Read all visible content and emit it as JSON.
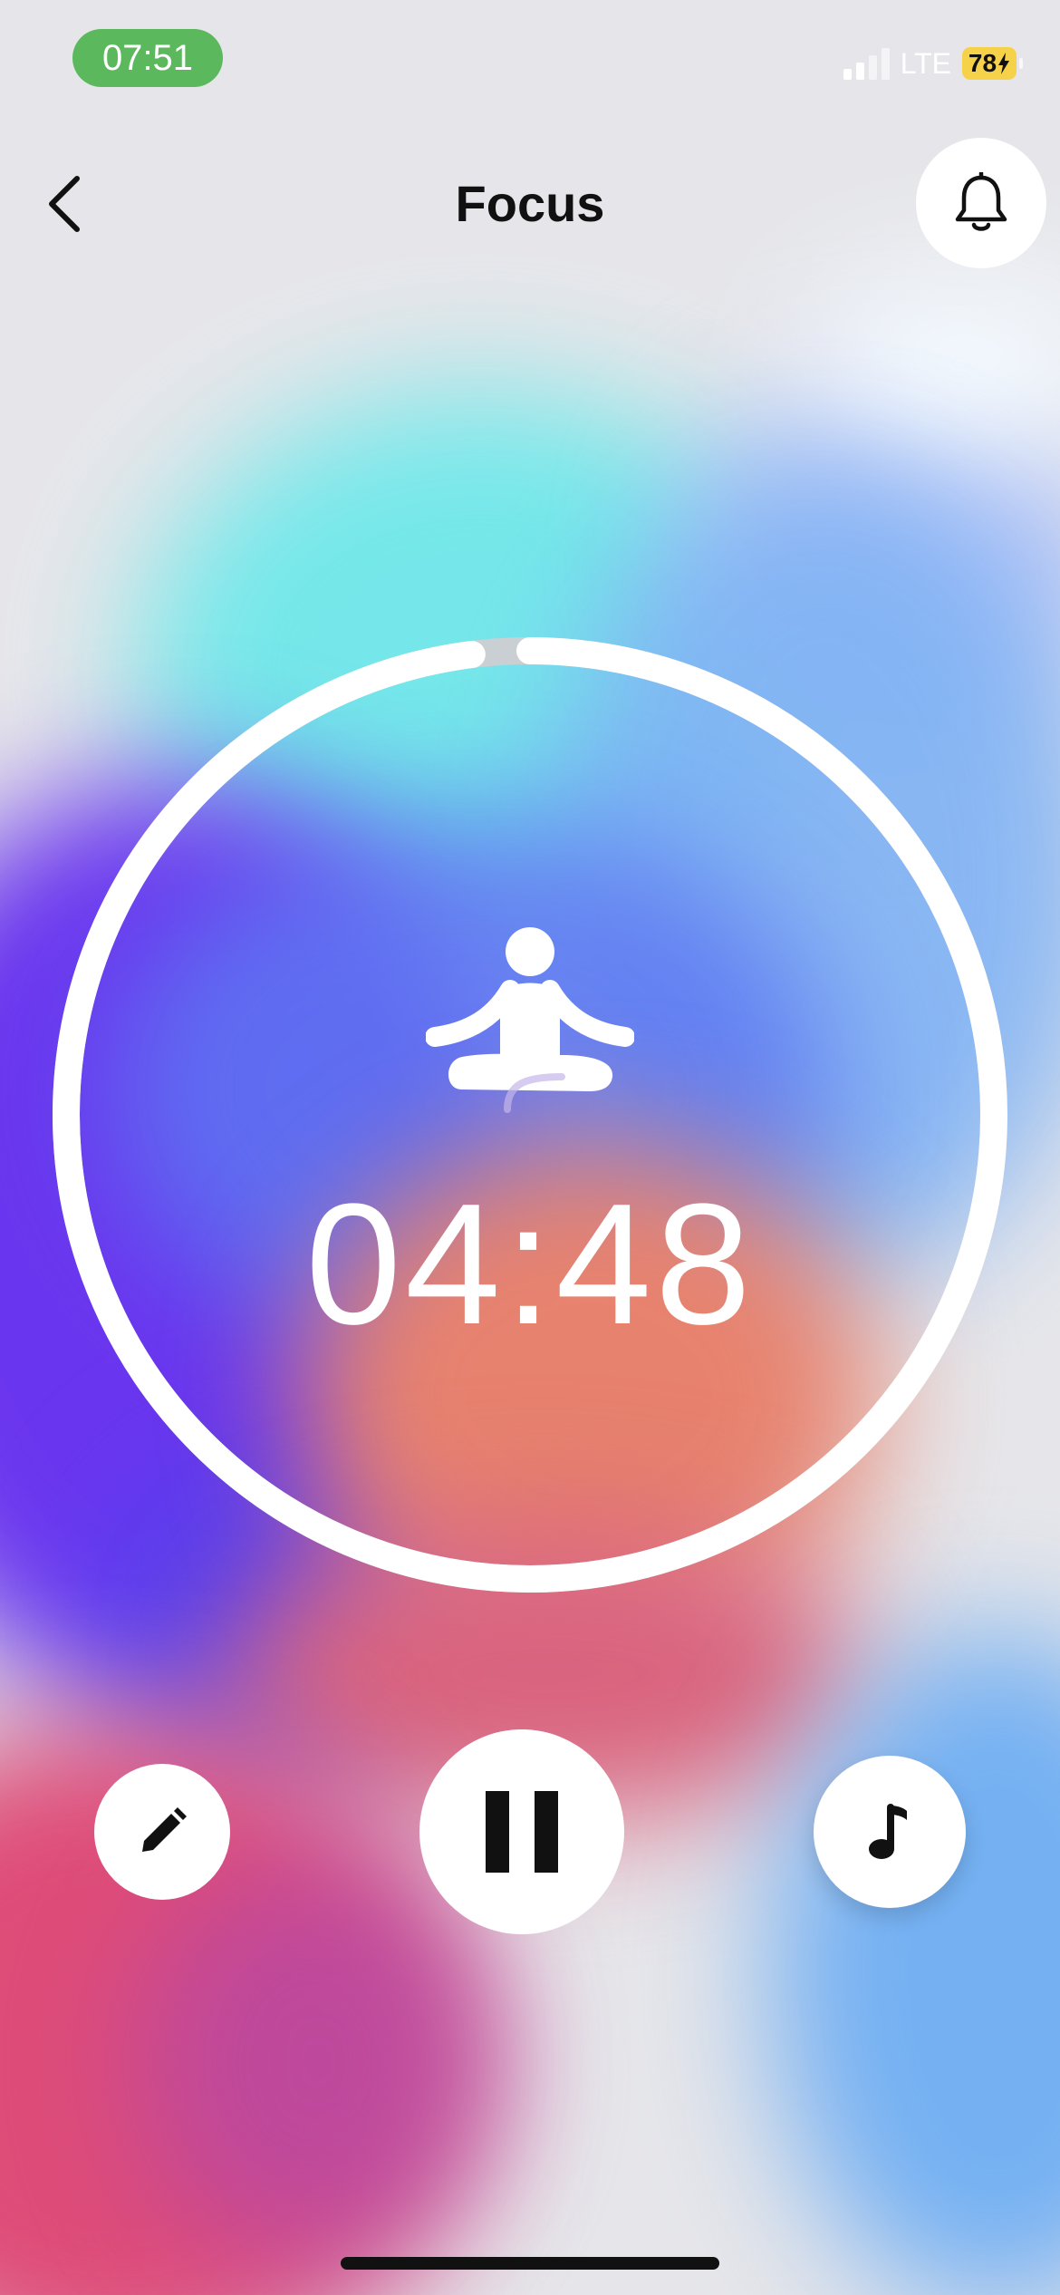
{
  "status_bar": {
    "time": "07:51",
    "network": "LTE",
    "battery": "78",
    "time_pill_color": "#5cb85c",
    "battery_color": "#f5d24a"
  },
  "header": {
    "title": "Focus",
    "back_icon": "chevron-left-icon",
    "bell_icon": "bell-icon"
  },
  "timer": {
    "remaining": "04:48",
    "progress": 0.98,
    "icon": "meditation-icon"
  },
  "controls": {
    "edit_icon": "pencil-icon",
    "pause_icon": "pause-icon",
    "music_icon": "music-note-icon"
  }
}
